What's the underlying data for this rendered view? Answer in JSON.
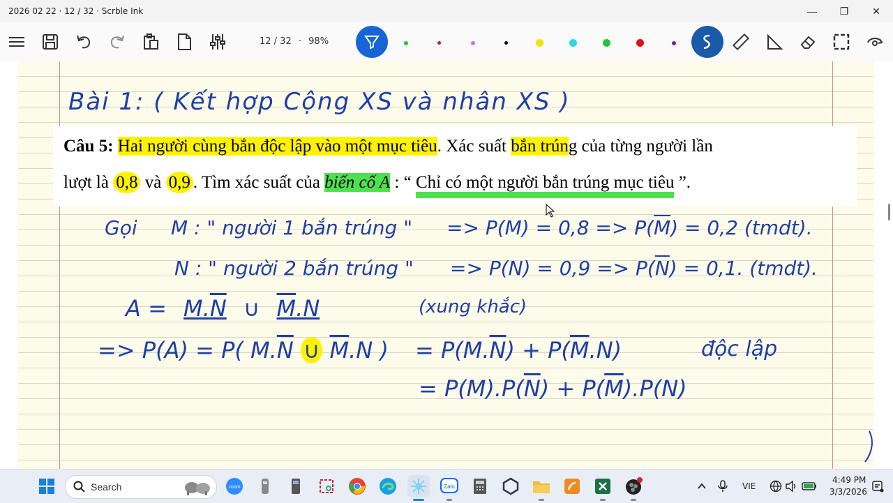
{
  "window": {
    "title": "2026 02 22 · 12 / 32 · Scrble Ink",
    "minimize_glyph": "—",
    "maximize_glyph": "❐",
    "close_glyph": "✕"
  },
  "toolbar": {
    "page_info": "12 / 32",
    "separator": "·",
    "zoom": "98%",
    "pen_colors": [
      "#2fbf2f",
      "#d4162a",
      "#e06bd6",
      "#111111",
      "#f5e000",
      "#2ed7e6",
      "#22c43a",
      "#e01010",
      "#7a1aa8"
    ],
    "accent": "#1565d8",
    "lasso_bg": "#1a5aa8"
  },
  "problem": {
    "label": "Câu 5:",
    "line1_a": "Hai người cùng bắn độc lập vào một mục tiêu",
    "line1_b": ". Xác suất ",
    "line1_c": "bắn trún",
    "line1_d": "g của từng người lần",
    "line2_a": "lượt là ",
    "line2_b": "0,8",
    "line2_c": " và ",
    "line2_d": "0,9",
    "line2_e": ". Tìm xác suất của ",
    "line2_f": "biến cố  A",
    "line2_g": " : “ ",
    "line2_h": "Chỉ có một người bắn trúng mục tiêu",
    "line2_i": " ”."
  },
  "notes": {
    "title": "Bài 1:  ( Kết hợp  Cộng  XS  và  nhân  XS )",
    "goi": "Gọi",
    "m_def": "M : \" người 1 bắn trúng \"",
    "m_prob": "=>  P(M) = 0,8  =>  P(",
    "m_bar": "M",
    "m_prob_end": ") = 0,2  (tmdt).",
    "n_def": "N : \" người 2 bắn trúng \"",
    "n_prob": "=>  P(N) = 0,9  =>  P(",
    "n_bar": "N",
    "n_prob_end": ") = 0,1.  (tmdt).",
    "a_eq_a": "A  =",
    "a_term1_a": "M.",
    "a_term1_b": "N",
    "a_union": "∪",
    "a_term2_a": "M",
    "a_term2_b": ".N",
    "a_note": "(xung khắc)",
    "pa_a": "=>  P(A) = P( M.",
    "pa_nbar": "N",
    "pa_union": "∪",
    "pa_mbar": "M",
    "pa_b": ".N )",
    "pa_c": "=  P(M.",
    "pa_d": ") + P(",
    "pa_e": ".N)",
    "pa_note": "độc lập",
    "pa2_a": "=  P(M).P(",
    "pa2_b": ") + P(",
    "pa2_c": ").P(N)"
  },
  "taskbar": {
    "search_placeholder": "Search",
    "lang": "VIE",
    "time": "4:49 PM",
    "date": "3/3/2026",
    "zoom_label": "zoom",
    "zalo_label": "Zalo",
    "accent_icons": {
      "zoom": "#2d8cff",
      "chrome_red": "#ea4335",
      "chrome_yellow": "#fbbc05",
      "chrome_green": "#34a853",
      "edge": "#1a9ee6",
      "zalo": "#0068ff",
      "folder": "#f4b942",
      "excel": "#1d7044",
      "foxit": "#f08a24"
    }
  }
}
